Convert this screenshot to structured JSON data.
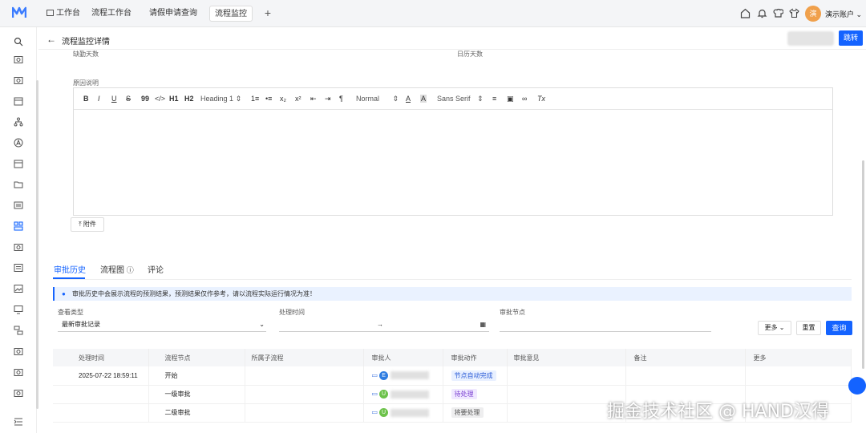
{
  "topbar": {
    "tabs": [
      "工作台",
      "流程工作台",
      "请假申请查询",
      "流程监控"
    ],
    "add_tab": "+",
    "user": {
      "avatar_text": "演",
      "name": "演示账户"
    }
  },
  "header": {
    "back": "←",
    "title": "流程监控详情",
    "jump_button": "跳转"
  },
  "form": {
    "label_missing_days": "缺勤天数",
    "label_days": "日历天数",
    "label_reason": "原因说明",
    "attach_label": "附件"
  },
  "toolbar": {
    "bold": "B",
    "italic": "I",
    "underline": "U",
    "strike": "S",
    "quote": "99",
    "code": "</>",
    "h1": "H1",
    "h2": "H2",
    "heading": "Heading 1",
    "ol": "1≡",
    "ul": "•≡",
    "sub": "x₂",
    "sup": "x²",
    "outdent": "⇤",
    "indent": "⇥",
    "rtl": "¶",
    "size": "Normal",
    "font": "Sans Serif",
    "clean": "Tx"
  },
  "content_tabs": {
    "history": "审批历史",
    "flowchart": "流程图",
    "comments": "评论"
  },
  "notice": "审批历史中会展示流程的预测结果，预测结果仅作参考，请以流程实际运行情况为准！",
  "filters": {
    "view_type_label": "查看类型",
    "view_type_value": "最新审批记录",
    "time_label": "处理时间",
    "time_sep": "→",
    "node_label": "审批节点",
    "more": "更多",
    "reset": "重置",
    "search": "查询"
  },
  "table": {
    "headers": [
      "处理时间",
      "流程节点",
      "所属子流程",
      "审批人",
      "审批动作",
      "审批意见",
      "备注",
      "更多"
    ],
    "rows": [
      {
        "time": "2025-07-22 18:59:11",
        "node": "开始",
        "avatar": "E",
        "action": "节点自动完成",
        "tag": "blue"
      },
      {
        "time": "",
        "node": "一级审批",
        "avatar": "U",
        "action": "待处理",
        "tag": "purple"
      },
      {
        "time": "",
        "node": "二级审批",
        "avatar": "U",
        "action": "将要处理",
        "tag": "gray"
      }
    ]
  },
  "watermark": "掘金技术社区 @ HAND汉得",
  "colors": {
    "primary": "#1463ff",
    "avatar_e": "#2f7de1",
    "avatar_u": "#6cc24a"
  }
}
